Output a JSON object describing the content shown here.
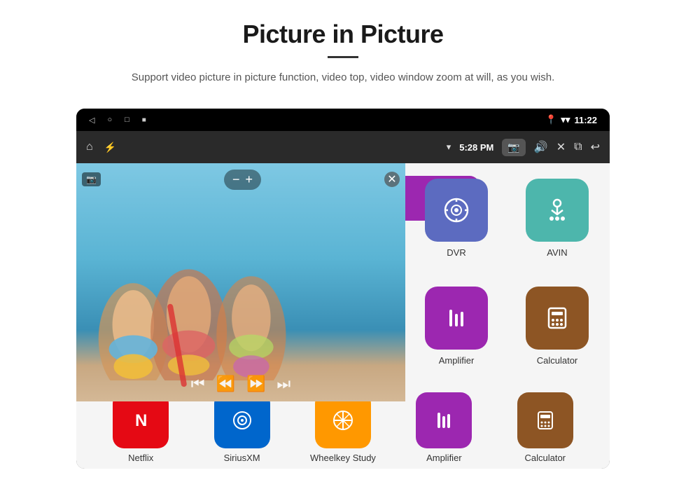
{
  "header": {
    "title": "Picture in Picture",
    "subtitle": "Support video picture in picture function, video top, video window zoom at will, as you wish."
  },
  "statusBar": {
    "time": "11:22",
    "navIcons": [
      "◁",
      "○",
      "□",
      "⬛"
    ]
  },
  "toolbar": {
    "time": "5:28 PM",
    "homeIcon": "⌂",
    "usbIcon": "⚡",
    "wifiIcon": "▾",
    "cameraIcon": "📷",
    "soundIcon": "🔊",
    "closeIcon": "✕",
    "windowIcon": "⧉",
    "backIcon": "↩"
  },
  "pip": {
    "minusBtn": "−",
    "plusBtn": "+",
    "closeBtn": "✕",
    "prevBtn": "⏮",
    "rewindBtn": "⏪",
    "forwardBtn": "⏩",
    "nextBtn": "⏭"
  },
  "apps": {
    "grid": [
      {
        "id": "dvr",
        "label": "DVR",
        "colorClass": "app-dvr",
        "icon": "📡"
      },
      {
        "id": "avin",
        "label": "AVIN",
        "colorClass": "app-avin",
        "icon": "🔌"
      },
      {
        "id": "amplifier",
        "label": "Amplifier",
        "colorClass": "app-amplifier",
        "icon": "🎚"
      },
      {
        "id": "calculator",
        "label": "Calculator",
        "colorClass": "app-calculator",
        "icon": "🧮"
      }
    ],
    "bottomRow": [
      {
        "id": "netflix",
        "label": "Netflix",
        "colorClass": "app-netflix",
        "icon": "N"
      },
      {
        "id": "siriusxm",
        "label": "SiriusXM",
        "colorClass": "app-sirius",
        "icon": "◎"
      },
      {
        "id": "wheelkey",
        "label": "Wheelkey Study",
        "colorClass": "app-wheelkey",
        "icon": "⚙"
      }
    ]
  }
}
